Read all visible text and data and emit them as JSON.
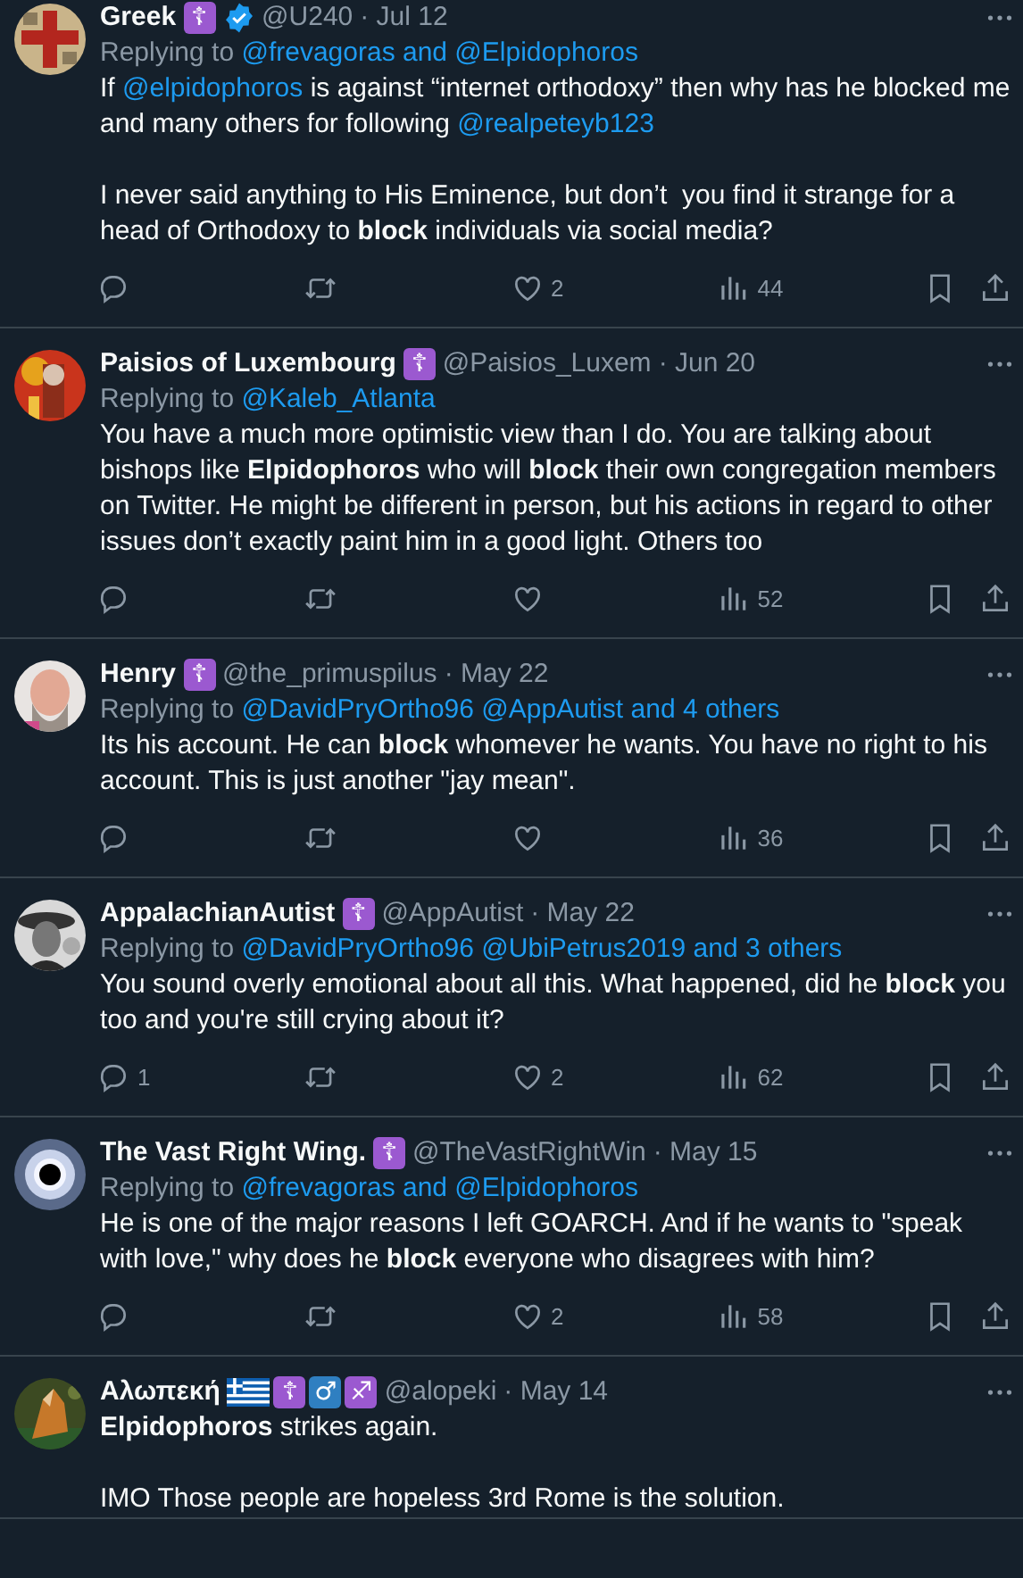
{
  "tweets": [
    {
      "name": "Greek",
      "badges": [
        {
          "kind": "cross",
          "text": "☦"
        }
      ],
      "verified": true,
      "handle": "@U240",
      "date": "· Jul 12",
      "replying_label": "Replying to",
      "replying_to": "@frevagoras and @Elpidophoros",
      "paragraphs": [
        [
          {
            "kind": "plain",
            "text": "If "
          },
          {
            "kind": "mention",
            "text": "@elpidophoros"
          },
          {
            "kind": "plain",
            "text": " is against “internet orthodoxy” then why has he blocked me and many others for following "
          },
          {
            "kind": "mention",
            "text": "@realpeteyb123"
          }
        ],
        [
          {
            "kind": "plain",
            "text": "I never said anything to His Eminence, but don’t  you find it strange for a head of Orthodoxy to "
          },
          {
            "kind": "bold",
            "text": "block"
          },
          {
            "kind": "plain",
            "text": " individuals via social media?"
          }
        ]
      ],
      "likes": "2",
      "views": "44"
    },
    {
      "name": "Paisios of Luxembourg",
      "badges": [
        {
          "kind": "cross",
          "text": "☦"
        }
      ],
      "verified": false,
      "handle": "@Paisios_Luxem",
      "date": "· Jun 20",
      "replying_label": "Replying to",
      "replying_to": "@Kaleb_Atlanta",
      "paragraphs": [
        [
          {
            "kind": "plain",
            "text": "You have a much more optimistic view than I do. You are talking about bishops like "
          },
          {
            "kind": "bold",
            "text": "Elpidophoros"
          },
          {
            "kind": "plain",
            "text": " who will "
          },
          {
            "kind": "bold",
            "text": "block"
          },
          {
            "kind": "plain",
            "text": " their own congregation members on Twitter. He might be different in person, but his actions in regard to other issues don’t exactly paint him in a good light. Others too"
          }
        ]
      ],
      "views": "52"
    },
    {
      "name": "Henry",
      "badges": [
        {
          "kind": "cross",
          "text": "☦"
        }
      ],
      "verified": false,
      "handle": "@the_primuspilus",
      "date": "· May 22",
      "replying_label": "Replying to",
      "replying_to": "@DavidPryOrtho96 @AppAutist and 4 others",
      "paragraphs": [
        [
          {
            "kind": "plain",
            "text": "Its his account. He can "
          },
          {
            "kind": "bold",
            "text": "block"
          },
          {
            "kind": "plain",
            "text": " whomever he wants. You have no right to his account. This is just another \"jay mean\"."
          }
        ]
      ],
      "views": "36"
    },
    {
      "name": "AppalachianAutist",
      "badges": [
        {
          "kind": "cross",
          "text": "☦"
        }
      ],
      "verified": false,
      "handle": "@AppAutist",
      "date": "· May 22",
      "replying_label": "Replying to",
      "replying_to": "@DavidPryOrtho96 @UbiPetrus2019 and 3 others",
      "paragraphs": [
        [
          {
            "kind": "plain",
            "text": "You sound overly emotional about all this. What happened, did he "
          },
          {
            "kind": "bold",
            "text": "block"
          },
          {
            "kind": "plain",
            "text": " you too and you're still crying about it?"
          }
        ]
      ],
      "replies": "1",
      "likes": "2",
      "views": "62"
    },
    {
      "name": "The Vast Right Wing.",
      "badges": [
        {
          "kind": "cross",
          "text": "☦"
        }
      ],
      "verified": false,
      "handle": "@TheVastRightWin",
      "date": "· May 15",
      "replying_label": "Replying to",
      "replying_to": "@frevagoras and @Elpidophoros",
      "paragraphs": [
        [
          {
            "kind": "plain",
            "text": "He is one of the major reasons I left GOARCH. And if he wants to \"speak with love,\" why does he "
          },
          {
            "kind": "bold",
            "text": "block"
          },
          {
            "kind": "plain",
            "text": " everyone who disagrees with him?"
          }
        ]
      ],
      "likes": "2",
      "views": "58"
    },
    {
      "name": "Αλωπεκή",
      "badges": [
        {
          "kind": "flag"
        },
        {
          "kind": "cross",
          "text": "☦"
        },
        {
          "kind": "male",
          "text": "♂"
        },
        {
          "kind": "sagittarius",
          "text": "♐"
        }
      ],
      "verified": false,
      "handle": "@alopeki",
      "date": "· May 14",
      "paragraphs": [
        [
          {
            "kind": "bold",
            "text": "Elpidophoros"
          },
          {
            "kind": "plain",
            "text": " strikes again."
          }
        ],
        [
          {
            "kind": "plain",
            "text": "IMO Those people are hopeless 3rd Rome is the solution."
          }
        ]
      ]
    }
  ]
}
